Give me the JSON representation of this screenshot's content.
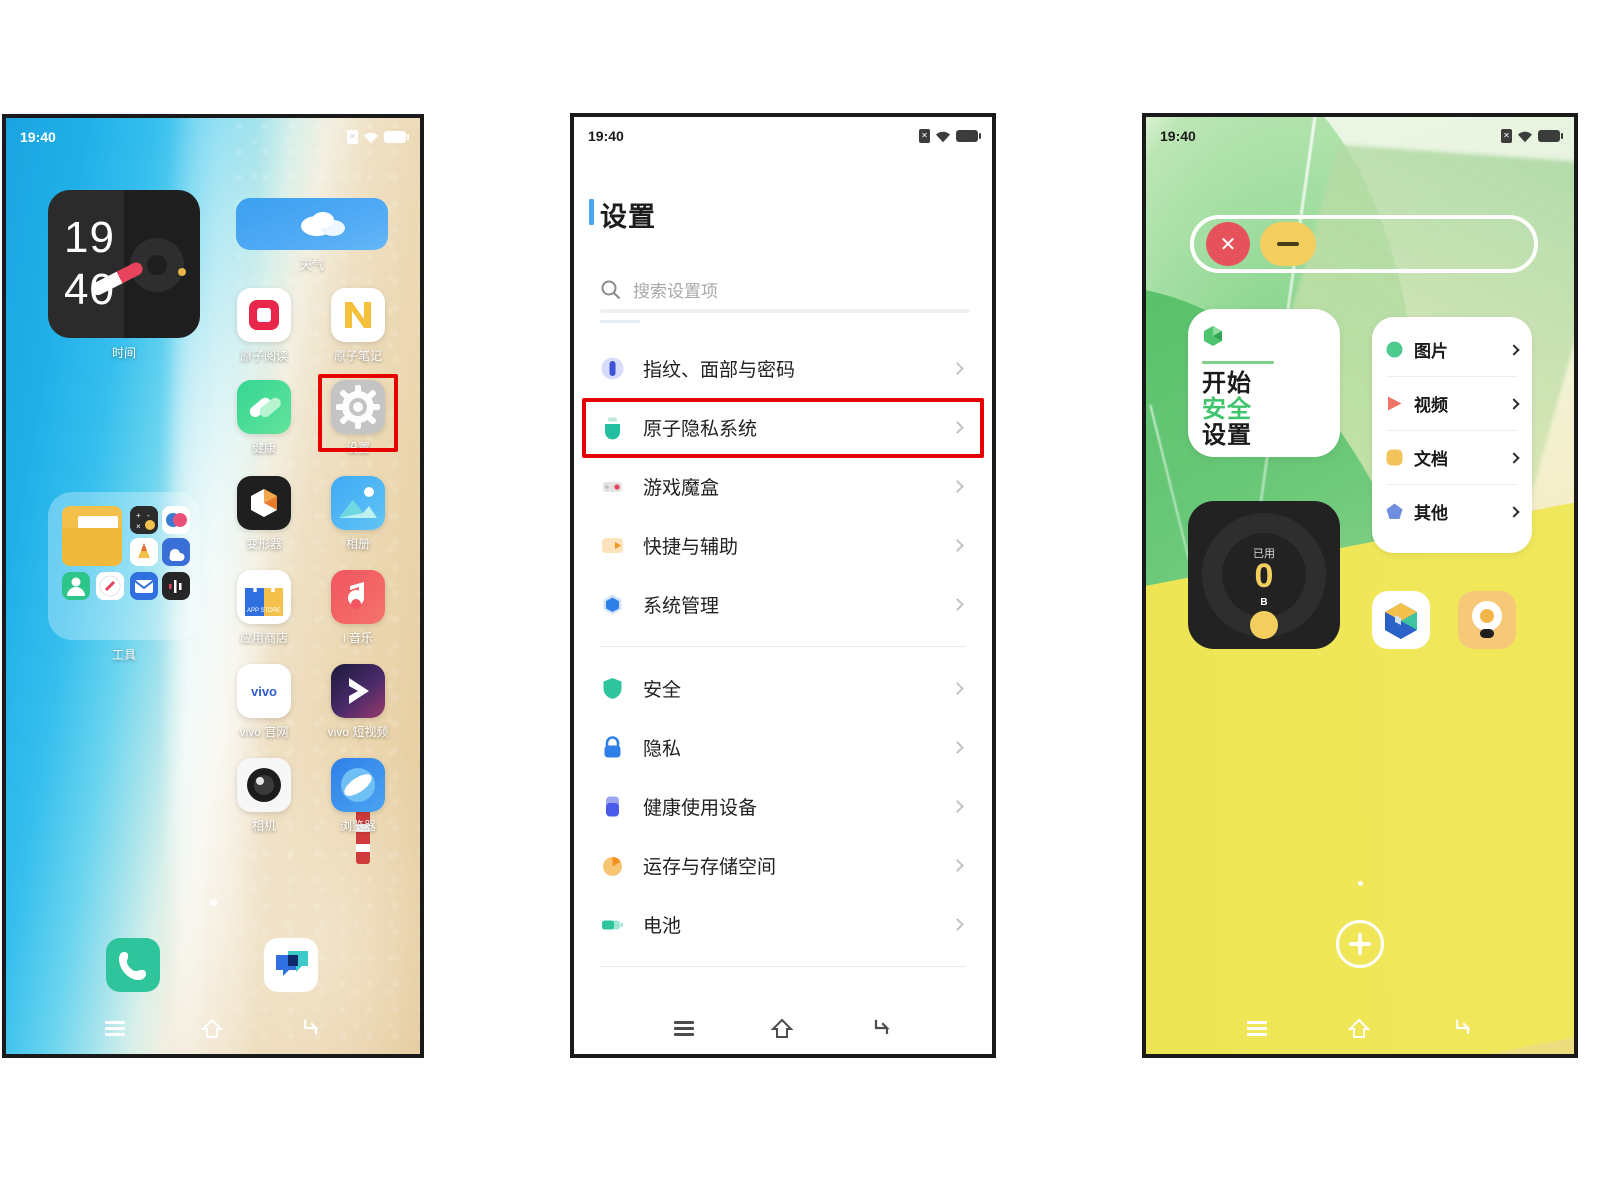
{
  "phones": [
    {
      "name": "home-screen",
      "status": {
        "time": "19:40",
        "sim_icon": "sim-card-off-icon",
        "wifi_icon": "wifi-icon",
        "battery_icon": "battery-icon"
      },
      "clock_widget": {
        "hours": "19",
        "minutes": "40",
        "label": "时间"
      },
      "weather_widget": {
        "label": "天气"
      },
      "folder": {
        "label": "工具"
      },
      "apps": [
        {
          "label": "原子阅读",
          "icon": "atomic-reader-icon"
        },
        {
          "label": "原子笔记",
          "icon": "atomic-notes-icon"
        },
        {
          "label": "健康",
          "icon": "health-icon"
        },
        {
          "label": "设置",
          "icon": "settings-gear-icon"
        },
        {
          "label": "变形器",
          "icon": "transformer-icon"
        },
        {
          "label": "相册",
          "icon": "gallery-icon"
        },
        {
          "label": "应用商店",
          "icon": "app-store-icon"
        },
        {
          "label": "i 音乐",
          "icon": "imusic-icon"
        },
        {
          "label": "vivo 官网",
          "icon": "vivo-official-icon"
        },
        {
          "label": "vivo 短视频",
          "icon": "vivo-shortvideo-icon"
        },
        {
          "label": "相机",
          "icon": "camera-icon"
        },
        {
          "label": "浏览器",
          "icon": "browser-icon"
        }
      ],
      "dock": [
        {
          "label": "电话",
          "icon": "phone-icon"
        },
        {
          "label": "信息",
          "icon": "messages-icon"
        }
      ],
      "nav": {
        "recents": "recents-icon",
        "home": "home-icon",
        "back": "back-icon"
      }
    },
    {
      "name": "settings-screen",
      "status": {
        "time": "19:40",
        "sim_icon": "sim-card-off-icon",
        "wifi_icon": "wifi-icon",
        "battery_icon": "battery-icon"
      },
      "title": "设置",
      "search": {
        "placeholder": "搜索设置项",
        "icon": "search-icon"
      },
      "groups": [
        {
          "items": [
            {
              "label": "指纹、面部与密码",
              "icon": "fingerprint-icon"
            },
            {
              "label": "原子隐私系统",
              "icon": "atomic-privacy-icon",
              "highlighted": true
            },
            {
              "label": "游戏魔盒",
              "icon": "game-box-icon"
            },
            {
              "label": "快捷与辅助",
              "icon": "shortcut-assist-icon"
            },
            {
              "label": "系统管理",
              "icon": "system-manage-icon"
            }
          ]
        },
        {
          "items": [
            {
              "label": "安全",
              "icon": "shield-icon"
            },
            {
              "label": "隐私",
              "icon": "lock-icon"
            },
            {
              "label": "健康使用设备",
              "icon": "digital-wellbeing-icon"
            },
            {
              "label": "运存与存储空间",
              "icon": "storage-pie-icon"
            },
            {
              "label": "电池",
              "icon": "battery-settings-icon"
            }
          ]
        }
      ],
      "nav": {
        "recents": "recents-icon",
        "home": "home-icon",
        "back": "back-icon"
      }
    },
    {
      "name": "atomic-privacy-screen",
      "status": {
        "time": "19:40",
        "sim_icon": "sim-card-off-icon",
        "wifi_icon": "wifi-icon",
        "battery_icon": "battery-icon"
      },
      "search_bar": {
        "close_label": "✕",
        "minimize_icon": "minimize-icon"
      },
      "start_card": {
        "icon": "cube-icon",
        "line1": "开始",
        "line2": "安全",
        "line3": "设置"
      },
      "file_types": [
        {
          "label": "图片",
          "icon": "circle-green-icon"
        },
        {
          "label": "视频",
          "icon": "triangle-red-icon"
        },
        {
          "label": "文档",
          "icon": "rounded-square-yellow-icon"
        },
        {
          "label": "其他",
          "icon": "pentagon-blue-icon"
        }
      ],
      "storage_card": {
        "used_label": "已用",
        "value": "0",
        "unit": "B"
      },
      "privacy_apps": [
        {
          "icon": "atomic-cube-icon"
        },
        {
          "icon": "atomic-lamp-icon"
        }
      ],
      "add_button": {
        "icon": "plus-icon"
      },
      "nav": {
        "recents": "recents-icon",
        "home": "home-icon",
        "back": "back-icon"
      }
    }
  ],
  "colors": {
    "highlight_red": "#e60000",
    "accent_blue": "#4aa8f0",
    "green": "#3ec46b",
    "yellow": "#f3cd5e"
  }
}
